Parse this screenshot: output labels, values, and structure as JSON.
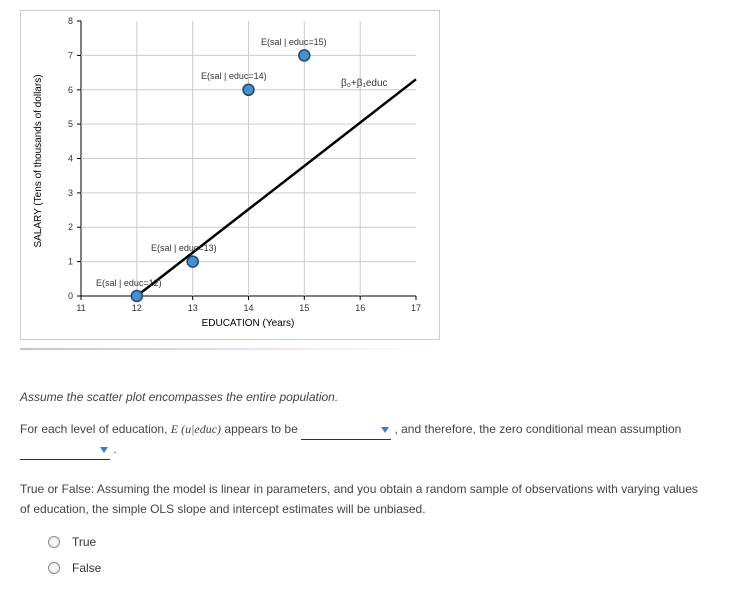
{
  "chart_data": {
    "type": "scatter",
    "title": "",
    "xlabel": "EDUCATION (Years)",
    "ylabel": "SALARY (Tens of thousands of dollars)",
    "xlim": [
      11,
      17
    ],
    "ylim": [
      0,
      8
    ],
    "x_ticks": [
      11,
      12,
      13,
      14,
      15,
      16,
      17
    ],
    "y_ticks": [
      0,
      1,
      2,
      3,
      4,
      5,
      6,
      7,
      8
    ],
    "series": [
      {
        "name": "E(sal|educ)",
        "type": "scatter",
        "points": [
          {
            "x": 12,
            "y": 0,
            "label": "E(sal | educ=12)"
          },
          {
            "x": 13,
            "y": 1,
            "label": "E(sal | educ=13)"
          },
          {
            "x": 14,
            "y": 6,
            "label": "E(sal | educ=14)"
          },
          {
            "x": 15,
            "y": 7,
            "label": "E(sal | educ=15)"
          }
        ]
      },
      {
        "name": "β₀+β₁educ",
        "type": "line",
        "points": [
          {
            "x": 12,
            "y": 0
          },
          {
            "x": 17,
            "y": 6.3
          }
        ]
      }
    ],
    "line_label": "β₀+β₁educ"
  },
  "questions": {
    "assume_text": "Assume the scatter plot encompasses the entire population.",
    "fill_prefix": "For each level of education, ",
    "fill_expr": "E (u|educ)",
    "fill_mid1": " appears to be ",
    "fill_mid2": " , and therefore, the zero conditional mean assumption ",
    "fill_end": " .",
    "tf_text": "True or False: Assuming the model is linear in parameters, and you obtain a random sample of observations with varying values of education, the simple OLS slope and intercept estimates will be unbiased.",
    "options": {
      "true": "True",
      "false": "False"
    }
  }
}
